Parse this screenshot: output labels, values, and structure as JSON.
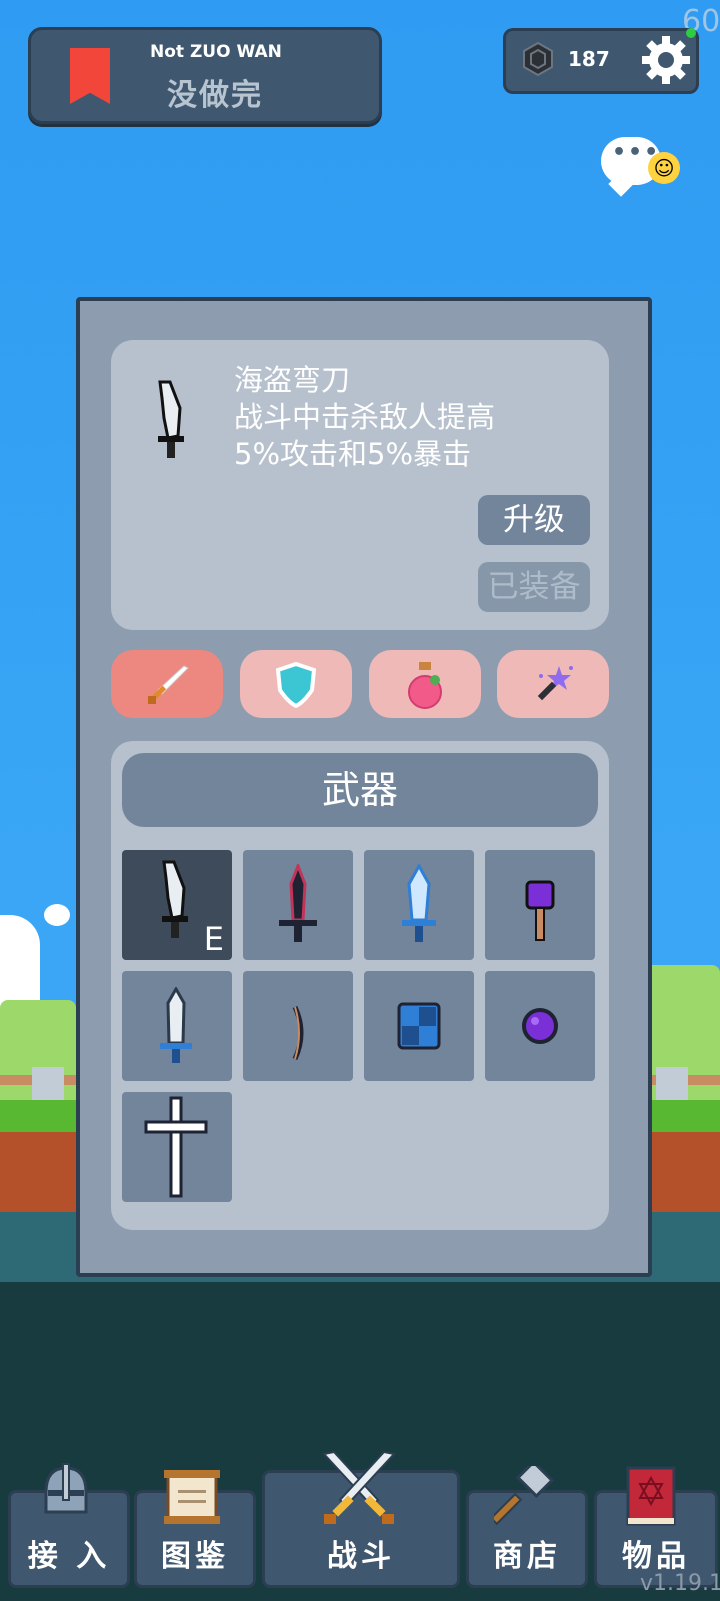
{
  "status": {
    "fps": "60"
  },
  "header": {
    "subtitle_en": "Not ZUO WAN",
    "subtitle_cn": "没做完",
    "gem_count": "187"
  },
  "item": {
    "name": "海盗弯刀",
    "desc_line1": "战斗中击杀敌人提高",
    "desc_line2": "5%攻击和5%暴击",
    "upgrade_label": "升级",
    "equipped_label": "已装备"
  },
  "tabs": [
    {
      "icon": "sword-icon",
      "active": true
    },
    {
      "icon": "shield-icon",
      "active": false
    },
    {
      "icon": "potion-icon",
      "active": false
    },
    {
      "icon": "magic-wand-icon",
      "active": false
    }
  ],
  "inventory": {
    "title": "武器",
    "equipped_marker": "E",
    "slots": [
      {
        "icon": "pirate-cutlass-icon",
        "equipped": true
      },
      {
        "icon": "dark-dagger-icon"
      },
      {
        "icon": "ice-sword-icon"
      },
      {
        "icon": "purple-staff-icon"
      },
      {
        "icon": "blue-short-sword-icon"
      },
      {
        "icon": "bow-icon"
      },
      {
        "icon": "blue-shield-icon"
      },
      {
        "icon": "purple-orb-icon"
      },
      {
        "icon": "cross-icon"
      }
    ]
  },
  "nav": [
    {
      "label": "接 入",
      "icon": "knight-helmet-icon"
    },
    {
      "label": "图鉴",
      "icon": "scroll-icon"
    },
    {
      "label": "战斗",
      "icon": "crossed-swords-icon"
    },
    {
      "label": "商店",
      "icon": "hammer-icon"
    },
    {
      "label": "物品",
      "icon": "spellbook-icon"
    }
  ],
  "footer": {
    "version": "v1.19.1"
  },
  "colors": {
    "accent_tab": "#ec8880",
    "panel": "#8d9caf",
    "button": "#72859b",
    "header": "#3f5870"
  }
}
